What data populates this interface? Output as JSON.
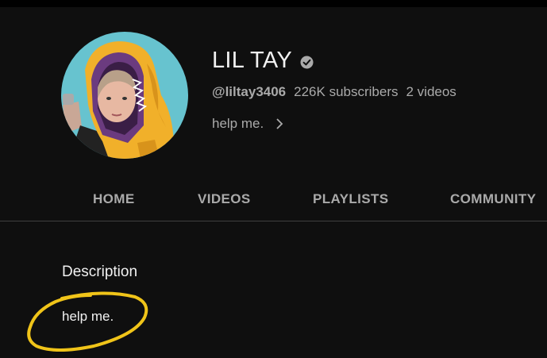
{
  "channel": {
    "name": "LIL TAY",
    "handle": "@liltay3406",
    "subscribers": "226K subscribers",
    "videos": "2 videos",
    "about_teaser": "help me.",
    "verified_icon": "check-circle-icon"
  },
  "tabs": [
    {
      "label": "HOME"
    },
    {
      "label": "VIDEOS"
    },
    {
      "label": "PLAYLISTS"
    },
    {
      "label": "COMMUNITY"
    }
  ],
  "about": {
    "heading": "Description",
    "text": "help me."
  },
  "colors": {
    "background": "#0f0f0f",
    "text_primary": "#f1f1f1",
    "text_secondary": "#aaaaaa",
    "divider": "#3f3f3f",
    "annotation": "#f0c419"
  }
}
